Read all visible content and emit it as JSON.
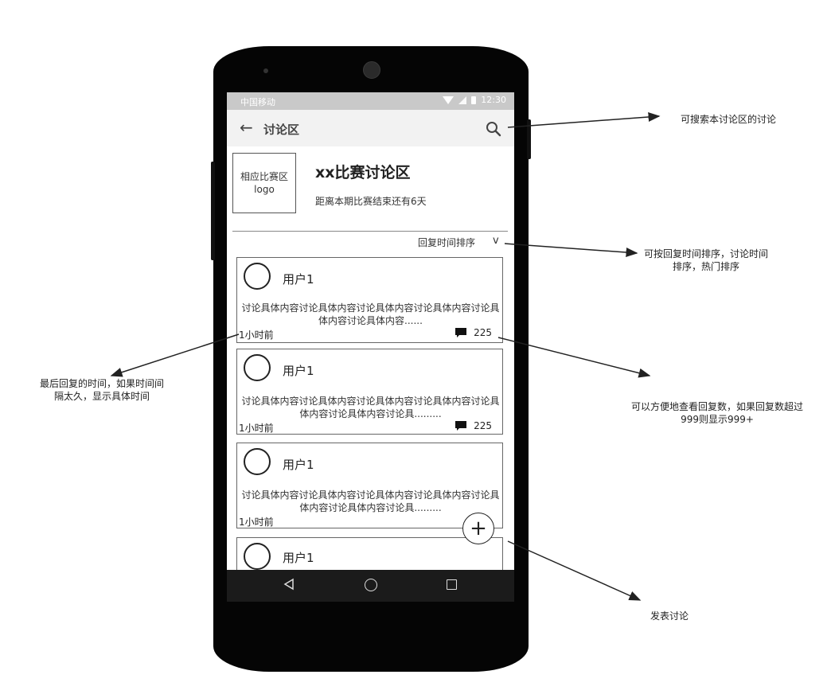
{
  "status_bar": {
    "carrier": "中国移动",
    "time": "12:30"
  },
  "app_bar": {
    "title": "讨论区",
    "back_icon": "arrow-left-icon",
    "search_icon": "search-icon"
  },
  "forum": {
    "logo_placeholder": "相应比赛区logo",
    "title": "xx比赛讨论区",
    "subtitle": "距离本期比赛结束还有6天",
    "sort_label": "回复时间排序",
    "sort_chevron": "v"
  },
  "posts": [
    {
      "user": "用户1",
      "content": "讨论具体内容讨论具体内容讨论具体内容讨论具体内容讨论具体内容讨论具体内容......",
      "time": "1小时前",
      "replies": "225"
    },
    {
      "user": "用户1",
      "content": "讨论具体内容讨论具体内容讨论具体内容讨论具体内容讨论具体内容讨论具体内容讨论具.........",
      "time": "1小时前",
      "replies": "225"
    },
    {
      "user": "用户1",
      "content": "讨论具体内容讨论具体内容讨论具体内容讨论具体内容讨论具体内容讨论具体内容讨论具.........",
      "time": "1小时前"
    },
    {
      "user": "用户1"
    }
  ],
  "fab": {
    "symbol": "+",
    "icon": "plus-icon"
  },
  "annotations": {
    "search": "可搜索本讨论区的讨论",
    "sort": "可按回复时间排序，讨论时间排序，热门排序",
    "time": "最后回复的时间，如果时间间隔太久，显示具体时间",
    "replies": "可以方便地查看回复数，如果回复数超过999则显示999+",
    "post": "发表讨论"
  },
  "colors": {
    "status_bar": "#c9c9c9",
    "app_bar": "#f2f2f2",
    "phone": "#050505",
    "nav_bar": "#1b1b1b"
  }
}
